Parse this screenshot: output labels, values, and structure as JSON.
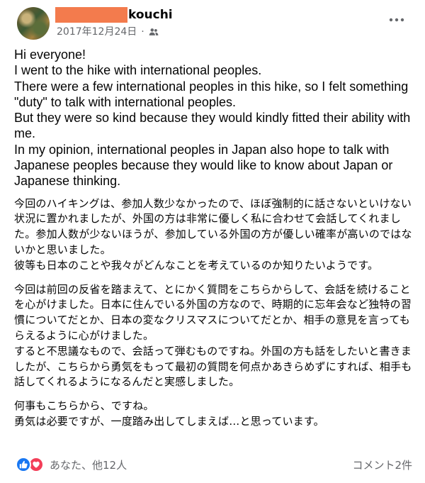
{
  "header": {
    "name_suffix": "kouchi",
    "date": "2017年12月24日",
    "separator": "·",
    "avatar": "avatar-photo",
    "audience_icon": "friends-icon",
    "more_icon": "more-dots-icon",
    "redaction_color": "#f37b4d"
  },
  "post": {
    "english": "Hi everyone!\nI went to the hike with international peoples.\nThere were a few international peoples in this hike, so I felt something \"duty\" to talk with international peoples.\nBut they were so kind because they would kindly fitted their ability with me.\nIn my opinion, international peoples in Japan also hope to talk with Japanese peoples because they would like to know about Japan or Japanese thinking.",
    "japanese_1": "今回のハイキングは、参加人数少なかったので、ほぼ強制的に話さないといけない状況に置かれましたが、外国の方は非常に優しく私に合わせて会話してくれました。参加人数が少ないほうが、参加している外国の方が優しい確率が高いのではないかと思いました。\n彼等も日本のことや我々がどんなことを考えているのか知りたいようです。",
    "japanese_2": "今回は前回の反省を踏まえて、とにかく質問をこちらからして、会話を続けることを心がけました。日本に住んでいる外国の方なので、時期的に忘年会など独特の習慣についてだとか、日本の変なクリスマスについてだとか、相手の意見を言ってもらえるように心がけました。\nすると不思議なもので、会話って弾むものですね。外国の方も話をしたいと書きましたが、こちらから勇気をもって最初の質問を何点かあきらめずにすれば、相手も話してくれるようになるんだと実感しました。",
    "japanese_3": "何事もこちらから、ですね。\n勇気は必要ですが、一度踏み出してしまえば…と思っています。"
  },
  "footer": {
    "reactions_text": "あなた、他12人",
    "comments_text": "コメント2件",
    "like_icon": "like-icon",
    "love_icon": "love-icon",
    "like_color": "#1877f2",
    "love_color": "#f33e58"
  }
}
